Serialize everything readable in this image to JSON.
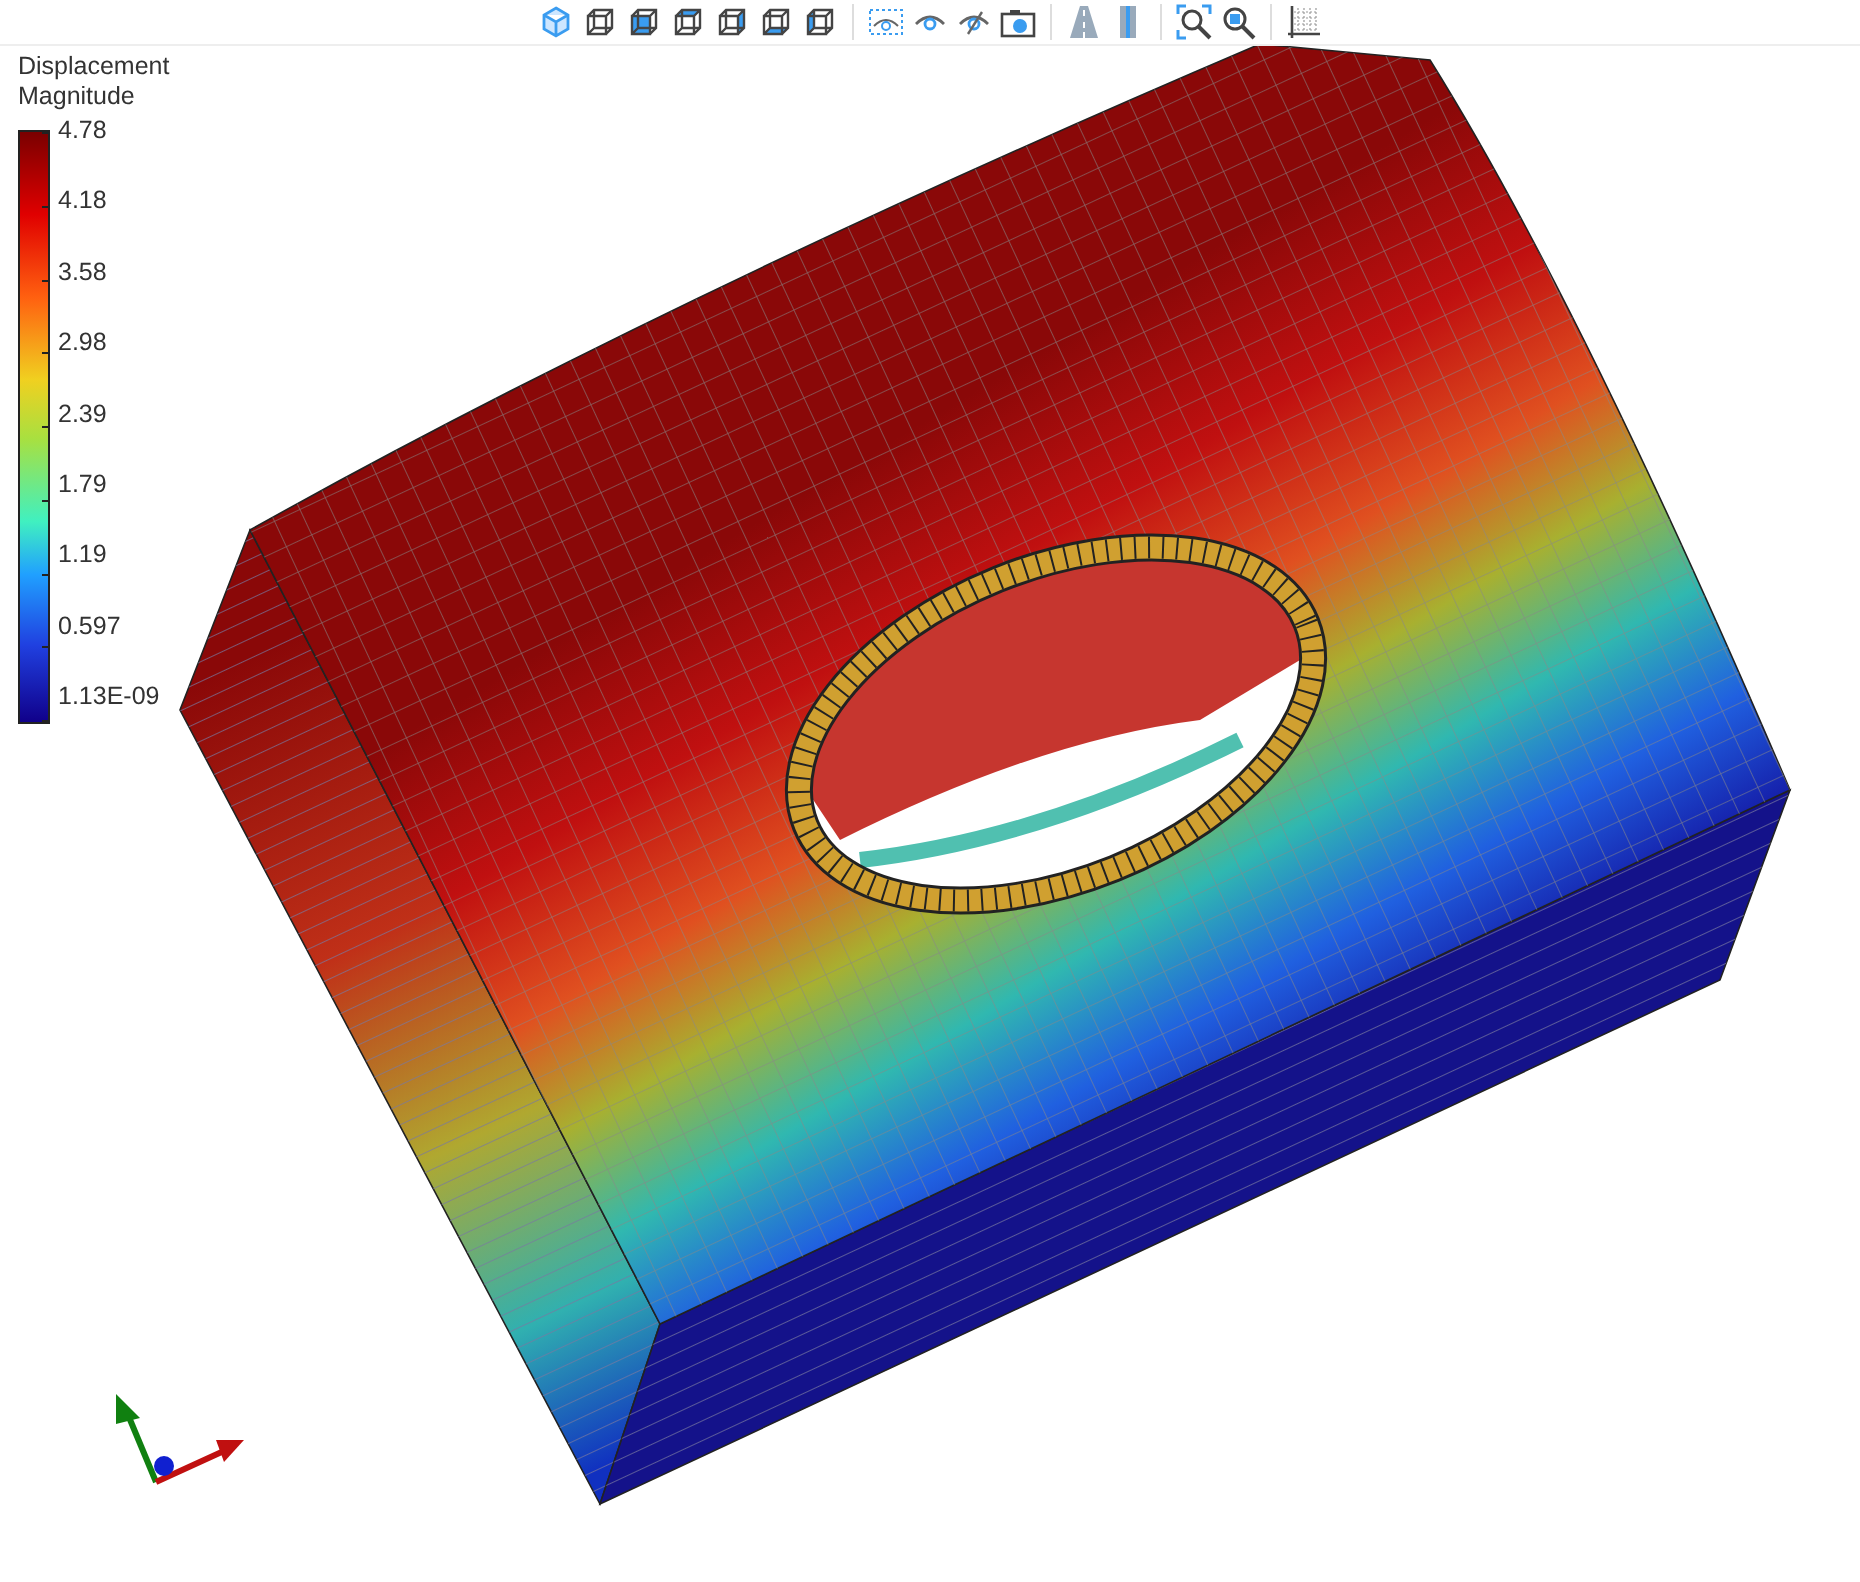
{
  "legend": {
    "title": "Displacement Magnitude",
    "ticks": [
      "4.78",
      "4.18",
      "3.58",
      "2.98",
      "2.39",
      "1.79",
      "1.19",
      "0.597",
      "1.13E-09"
    ]
  }
}
